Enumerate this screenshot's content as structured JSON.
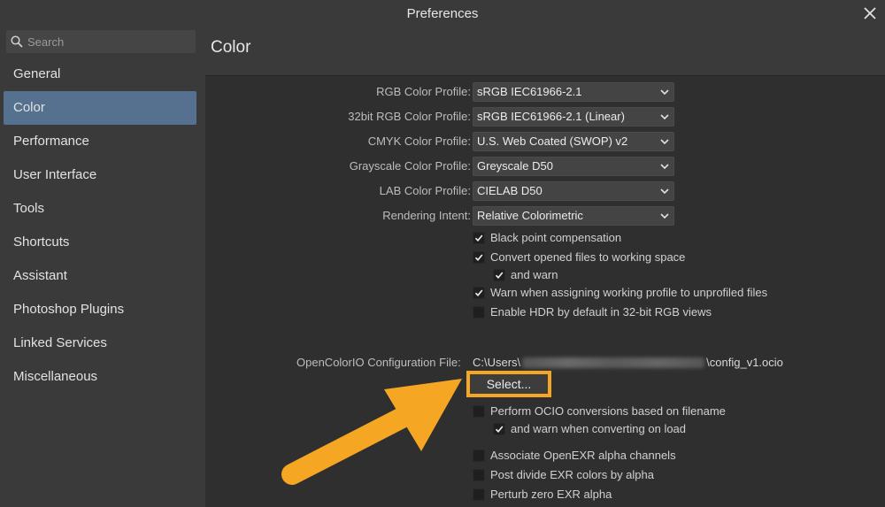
{
  "window": {
    "title": "Preferences"
  },
  "search": {
    "placeholder": "Search"
  },
  "sidebar": {
    "items": [
      {
        "label": "General"
      },
      {
        "label": "Color"
      },
      {
        "label": "Performance"
      },
      {
        "label": "User Interface"
      },
      {
        "label": "Tools"
      },
      {
        "label": "Shortcuts"
      },
      {
        "label": "Assistant"
      },
      {
        "label": "Photoshop Plugins"
      },
      {
        "label": "Linked Services"
      },
      {
        "label": "Miscellaneous"
      }
    ],
    "active_index": 1
  },
  "main": {
    "title": "Color",
    "profiles": [
      {
        "label": "RGB Color Profile:",
        "value": "sRGB IEC61966-2.1"
      },
      {
        "label": "32bit RGB Color Profile:",
        "value": "sRGB IEC61966-2.1 (Linear)"
      },
      {
        "label": "CMYK Color Profile:",
        "value": "U.S. Web Coated (SWOP) v2"
      },
      {
        "label": "Grayscale Color Profile:",
        "value": "Greyscale D50"
      },
      {
        "label": "LAB Color Profile:",
        "value": "CIELAB D50"
      },
      {
        "label": "Rendering Intent:",
        "value": "Relative Colorimetric"
      }
    ],
    "checks": [
      {
        "label": "Black point compensation",
        "checked": true
      },
      {
        "label": "Convert opened files to working space",
        "checked": true
      },
      {
        "label": "and warn",
        "checked": true
      },
      {
        "label": "Warn when assigning working profile to unprofiled files",
        "checked": true
      },
      {
        "label": "Enable HDR by default in 32-bit RGB views",
        "checked": false
      }
    ],
    "ocio": {
      "label": "OpenColorIO Configuration File:",
      "path_prefix": "C:\\Users\\",
      "path_suffix": "\\config_v1.ocio",
      "select_label": "Select..."
    },
    "ocio_checks": [
      {
        "label": "Perform OCIO conversions based on filename",
        "checked": false
      },
      {
        "label": "and warn when converting on load",
        "checked": true
      },
      {
        "label": "Associate OpenEXR alpha channels",
        "checked": false
      },
      {
        "label": "Post divide EXR colors by alpha",
        "checked": false
      },
      {
        "label": "Perturb zero EXR alpha",
        "checked": false
      }
    ]
  },
  "colors": {
    "accent": "#55718f",
    "highlight": "#f5a623"
  }
}
